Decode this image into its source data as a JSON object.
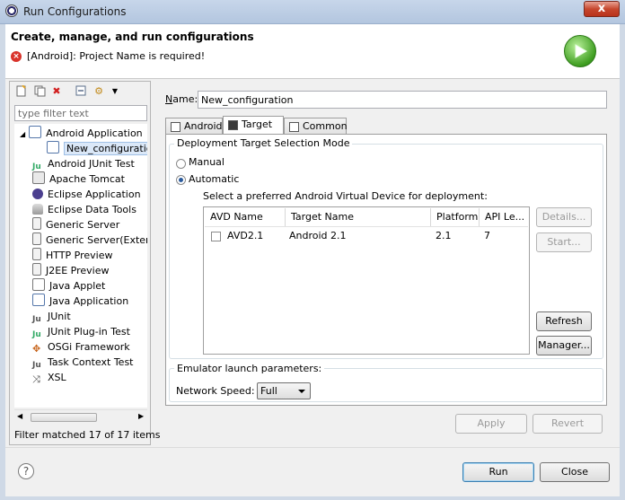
{
  "window": {
    "title": "Run Configurations",
    "close_glyph": "x"
  },
  "banner": {
    "heading": "Create, manage, and run configurations",
    "error_message": "[Android]: Project Name is required!",
    "error_icon": "error-icon",
    "logo_icon": "run-icon"
  },
  "toolbar": {
    "icons": [
      "new-launch-configuration-icon",
      "duplicate-icon",
      "delete-icon",
      "collapse-all-icon",
      "filter-icon",
      "view-menu-icon"
    ]
  },
  "filter": {
    "placeholder": "type filter text",
    "value": ""
  },
  "tree": {
    "items": [
      {
        "label": "Android Application",
        "icon": "android-app-icon",
        "expanded": true
      },
      {
        "label": "New_configuration",
        "icon": "config-icon",
        "selected": true
      },
      {
        "label": "Android JUnit Test",
        "icon": "junit-icon"
      },
      {
        "label": "Apache Tomcat",
        "icon": "tomcat-icon"
      },
      {
        "label": "Eclipse Application",
        "icon": "eclipse-icon"
      },
      {
        "label": "Eclipse Data Tools",
        "icon": "data-tools-icon"
      },
      {
        "label": "Generic Server",
        "icon": "server-icon"
      },
      {
        "label": "Generic Server(Externa",
        "icon": "server-icon"
      },
      {
        "label": "HTTP Preview",
        "icon": "preview-icon"
      },
      {
        "label": "J2EE Preview",
        "icon": "preview-icon"
      },
      {
        "label": "Java Applet",
        "icon": "applet-icon"
      },
      {
        "label": "Java Application",
        "icon": "java-app-icon"
      },
      {
        "label": "JUnit",
        "icon": "junit-icon"
      },
      {
        "label": "JUnit Plug-in Test",
        "icon": "junit-plugin-icon"
      },
      {
        "label": "OSGi Framework",
        "icon": "osgi-icon"
      },
      {
        "label": "Task Context Test",
        "icon": "task-icon"
      },
      {
        "label": "XSL",
        "icon": "xsl-icon"
      }
    ]
  },
  "status": {
    "filter_matched": "Filter matched 17 of 17 items"
  },
  "name_field": {
    "label_accel": "N",
    "label_rest": "ame:",
    "value": "New_configuration"
  },
  "tabs": [
    {
      "label": "Android",
      "icon": "android-tab-icon",
      "active": false
    },
    {
      "label": "Target",
      "icon": "target-tab-icon",
      "active": true
    },
    {
      "label": "Common",
      "icon": "common-tab-icon",
      "active": false
    }
  ],
  "deployment": {
    "group_title": "Deployment Target Selection Mode",
    "manual": "Manual",
    "automatic": "Automatic",
    "selected_mode": "automatic",
    "avd_prompt": "Select a preferred Android Virtual Device for deployment:",
    "columns": [
      "AVD Name",
      "Target Name",
      "Platform",
      "API Le..."
    ],
    "rows": [
      {
        "name": "AVD2.1",
        "target": "Android 2.1",
        "platform": "2.1",
        "api": "7",
        "checked": false
      }
    ],
    "buttons": {
      "details": "Details...",
      "start": "Start...",
      "refresh": "Refresh",
      "manager": "Manager..."
    }
  },
  "emulator": {
    "group_title": "Emulator launch parameters:",
    "network_speed_label": "Network Speed:",
    "network_speed_value": "Full"
  },
  "actions": {
    "apply": "Apply",
    "revert": "Revert",
    "run": "Run",
    "close": "Close",
    "help_glyph": "?"
  },
  "colors": {
    "error_red": "#d9332b",
    "run_green": "#3f9e21",
    "selection": "#dbe8f8"
  }
}
